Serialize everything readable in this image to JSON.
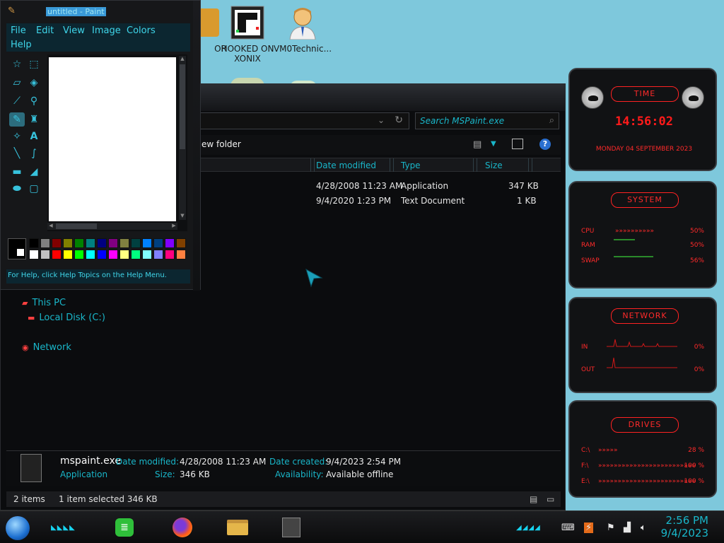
{
  "desktop": {
    "icons": [
      {
        "label_line1": "OR",
        "label_line2": ""
      },
      {
        "label_line1": "HOOKED ON",
        "label_line2": "XONIX"
      },
      {
        "label_line1": "VM0Technic...",
        "label_line2": ""
      }
    ]
  },
  "paint": {
    "title": "untitled - Paint",
    "menu": [
      "File",
      "Edit",
      "View",
      "Image",
      "Colors",
      "Help"
    ],
    "status": "For Help, click Help Topics on the Help Menu.",
    "palette_colors": [
      "#000000",
      "#808080",
      "#800000",
      "#808000",
      "#008000",
      "#008080",
      "#000080",
      "#800080",
      "#808040",
      "#004040",
      "#0080ff",
      "#004080",
      "#8000ff",
      "#804000",
      "#ffffff",
      "#c0c0c0",
      "#ff0000",
      "#ffff00",
      "#00ff00",
      "#00ffff",
      "#0000ff",
      "#ff00ff",
      "#ffff80",
      "#00ff80",
      "#80ffff",
      "#8080ff",
      "#ff0080",
      "#ff8040"
    ]
  },
  "explorer": {
    "search_placeholder": "Search MSPaint.exe",
    "new_folder": "ew folder",
    "columns": {
      "date_modified": "Date modified",
      "type": "Type",
      "size": "Size"
    },
    "files": [
      {
        "date": "4/28/2008 11:23 AM",
        "type": "Application",
        "size": "347 KB"
      },
      {
        "date": "9/4/2020 1:23 PM",
        "type": "Text Document",
        "size": "1 KB"
      }
    ],
    "nav": {
      "this_pc": "This PC",
      "local_disk": "Local Disk (C:)",
      "network": "Network"
    },
    "details": {
      "name": "mspaint.exe",
      "kind": "Application",
      "date_modified_label": "Date modified:",
      "date_modified_value": "4/28/2008 11:23 AM",
      "size_label": "Size:",
      "size_value": "346 KB",
      "date_created_label": "Date created:",
      "date_created_value": "9/4/2023 2:54 PM",
      "availability_label": "Availability:",
      "availability_value": "Available offline"
    },
    "status": {
      "items": "2 items",
      "selected": "1 item selected  346 KB"
    }
  },
  "gadgets": {
    "time": {
      "title": "TIME",
      "clock": "14:56:02",
      "date": "MONDAY 04 SEPTEMBER 2023"
    },
    "system": {
      "title": "SYSTEM",
      "rows": [
        {
          "label": "CPU",
          "value": "50%"
        },
        {
          "label": "RAM",
          "value": "50%"
        },
        {
          "label": "SWAP",
          "value": "56%"
        }
      ]
    },
    "network": {
      "title": "NETWORK",
      "rows": [
        {
          "label": "IN",
          "value": "0%"
        },
        {
          "label": "OUT",
          "value": "0%"
        }
      ]
    },
    "drives": {
      "title": "DRIVES",
      "rows": [
        {
          "label": "C:\\",
          "value": "28 %"
        },
        {
          "label": "F:\\",
          "value": "100 %"
        },
        {
          "label": "E:\\",
          "value": "100 %"
        }
      ]
    }
  },
  "taskbar": {
    "time": "2:56 PM",
    "date": "9/4/2023"
  }
}
